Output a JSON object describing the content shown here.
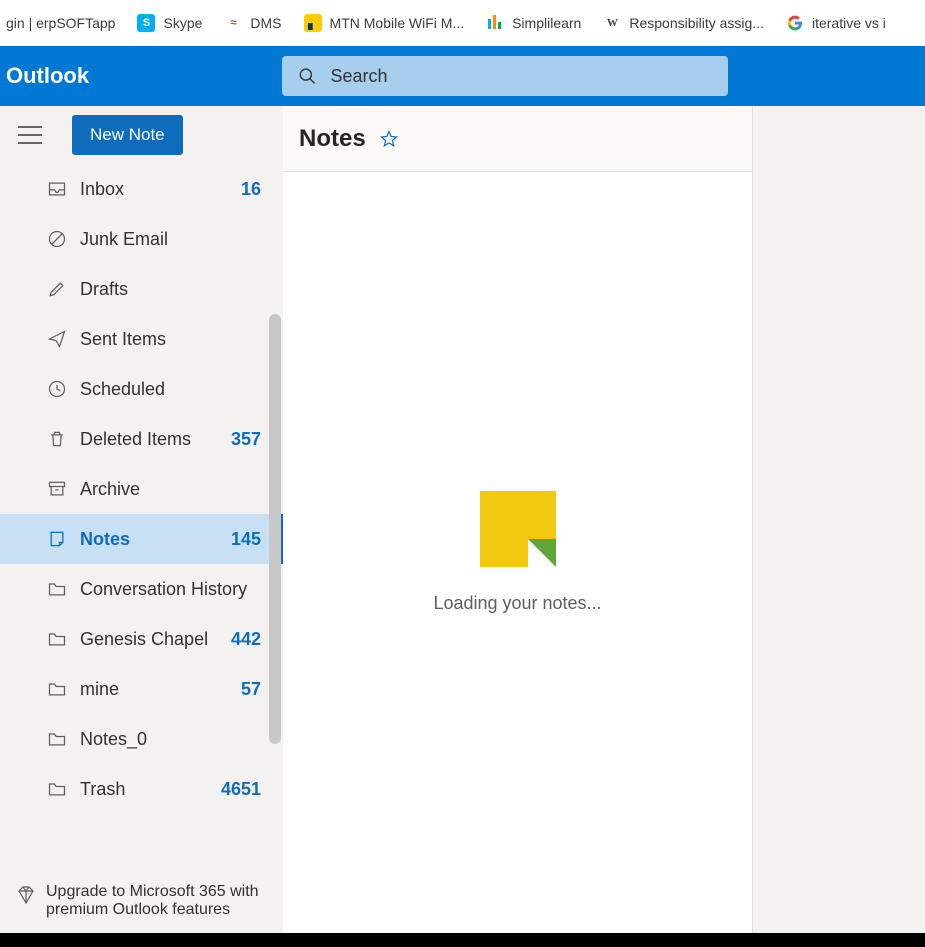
{
  "bookmarks": [
    {
      "label": "gin | erpSOFTapp",
      "icon": "generic"
    },
    {
      "label": "Skype",
      "icon": "skype"
    },
    {
      "label": "DMS",
      "icon": "dms"
    },
    {
      "label": "MTN Mobile WiFi M...",
      "icon": "mtn"
    },
    {
      "label": "Simplilearn",
      "icon": "simpli"
    },
    {
      "label": "Responsibility assig...",
      "icon": "wiki"
    },
    {
      "label": "iterative vs i",
      "icon": "google"
    }
  ],
  "header": {
    "title": "Outlook",
    "search_placeholder": "Search"
  },
  "sidebar": {
    "new_note_label": "New Note",
    "folders": [
      {
        "icon": "inbox",
        "label": "Inbox",
        "count": "16",
        "selected": false
      },
      {
        "icon": "junk",
        "label": "Junk Email",
        "count": "",
        "selected": false
      },
      {
        "icon": "drafts",
        "label": "Drafts",
        "count": "",
        "selected": false
      },
      {
        "icon": "sent",
        "label": "Sent Items",
        "count": "",
        "selected": false
      },
      {
        "icon": "clock",
        "label": "Scheduled",
        "count": "",
        "selected": false
      },
      {
        "icon": "trash",
        "label": "Deleted Items",
        "count": "357",
        "selected": false
      },
      {
        "icon": "archive",
        "label": "Archive",
        "count": "",
        "selected": false
      },
      {
        "icon": "note",
        "label": "Notes",
        "count": "145",
        "selected": true
      },
      {
        "icon": "folder",
        "label": "Conversation History",
        "count": "",
        "selected": false
      },
      {
        "icon": "folder",
        "label": "Genesis Chapel",
        "count": "442",
        "selected": false
      },
      {
        "icon": "folder",
        "label": "mine",
        "count": "57",
        "selected": false
      },
      {
        "icon": "folder",
        "label": "Notes_0",
        "count": "",
        "selected": false
      },
      {
        "icon": "folder",
        "label": "Trash",
        "count": "4651",
        "selected": false
      }
    ],
    "upgrade_text": "Upgrade to Microsoft 365 with premium Outlook features"
  },
  "main": {
    "title": "Notes",
    "loading_text": "Loading your notes..."
  }
}
